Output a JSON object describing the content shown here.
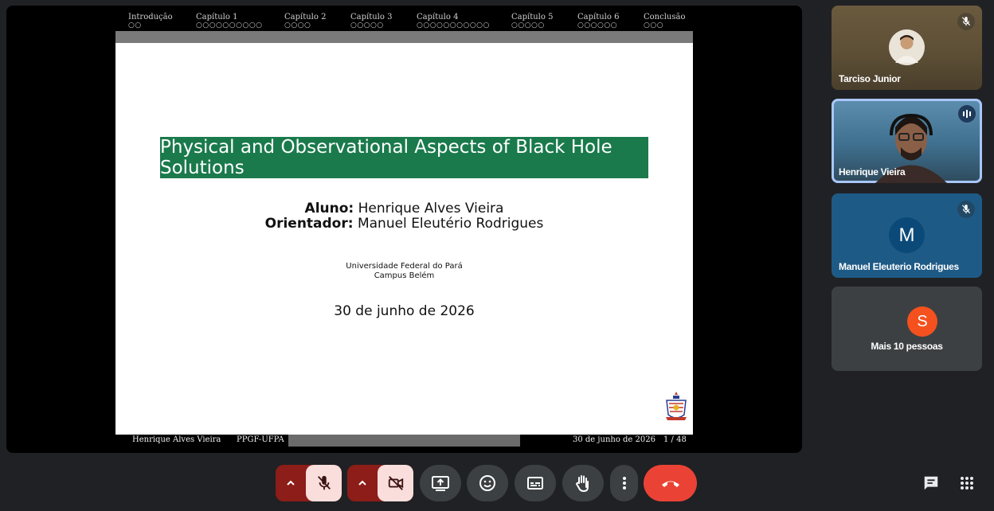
{
  "slide": {
    "sections": [
      {
        "name": "Introdução",
        "dots": "○○"
      },
      {
        "name": "Capítulo 1",
        "dots": "○○○○○○○○○○"
      },
      {
        "name": "Capítulo 2",
        "dots": "○○○○"
      },
      {
        "name": "Capítulo 3",
        "dots": "○○○○○"
      },
      {
        "name": "Capítulo 4",
        "dots": "○○○○○○○○○○○"
      },
      {
        "name": "Capítulo 5",
        "dots": "○○○○○"
      },
      {
        "name": "Capítulo 6",
        "dots": "○○○○○○"
      },
      {
        "name": "Conclusão",
        "dots": "○○○"
      }
    ],
    "title": "Physical and Observational Aspects of Black Hole Solutions",
    "student_label": "Aluno:",
    "student_name": "Henrique Alves Vieira",
    "advisor_label": "Orientador:",
    "advisor_name": "Manuel Eleutério Rodrigues",
    "university": "Universidade Federal do Pará",
    "campus": "Campus Belém",
    "date": "30 de junho de 2026",
    "footer": {
      "author": "Henrique Alves Vieira",
      "program": "PPGF-UFPA",
      "date": "30 de junho de 2026",
      "page": "1 / 48"
    },
    "title_color": "#1a7a4c"
  },
  "participants": [
    {
      "name": "Tarciso Junior",
      "muted": true
    },
    {
      "name": "Henrique Vieira",
      "speaking": true
    },
    {
      "name": "Manuel Eleuterio Rodrigues",
      "muted": true,
      "initial": "M"
    },
    {
      "name": "Mais 10 pessoas",
      "initial": "S"
    }
  ],
  "controls": {
    "icons": [
      "chevron-up-icon",
      "mic-off-icon",
      "chevron-up-icon",
      "camera-off-icon",
      "present-icon",
      "emoji-icon",
      "captions-icon",
      "raise-hand-icon",
      "more-vert-icon",
      "end-call-icon",
      "chat-icon",
      "activities-icon"
    ],
    "end_color": "#ea4335"
  }
}
